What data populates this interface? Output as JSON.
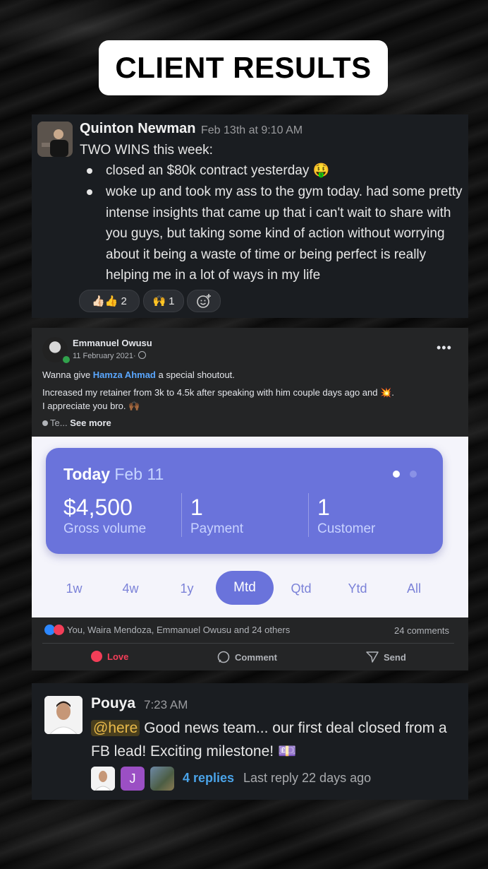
{
  "title": "CLIENT RESULTS",
  "post1": {
    "author": "Quinton Newman",
    "time": "Feb 13th at 9:10 AM",
    "intro": "TWO WINS this week:",
    "bullets": [
      "closed an $80k contract yesterday 🤑",
      "woke up and took my ass to the gym today. had some pretty intense insights that came up that i can't wait to share with you guys, but taking some kind of action without worrying about it being a waste of time or being perfect is really helping me in a lot of ways in my life"
    ],
    "reactions": [
      {
        "emoji": "👍🏻👍",
        "count": "2"
      },
      {
        "emoji": "🙌",
        "count": "1"
      }
    ],
    "add_reaction_icon": "add-emoji-icon"
  },
  "post2": {
    "author": "Emmanuel Owusu",
    "date": "11 February 2021·",
    "line1_prefix": "Wanna give ",
    "line1_link": "Hamza Ahmad",
    "line1_suffix": " a special shoutout.",
    "line2": "Increased my retainer from 3k to 4.5k after speaking with him couple days ago and 💥.",
    "line3": "I appreciate you bro. 🙌🏾",
    "translate_prefix": "Te...",
    "see_more": "See more",
    "stripe": {
      "today": "Today",
      "date": "Feb 11",
      "gross_value": "$4,500",
      "gross_label": "Gross volume",
      "payment_value": "1",
      "payment_label": "Payment",
      "customer_value": "1",
      "customer_label": "Customer",
      "periods": [
        "1w",
        "4w",
        "1y",
        "Mtd",
        "Qtd",
        "Ytd",
        "All"
      ],
      "active_period": "Mtd",
      "accent": "#6a73db"
    },
    "reactions_text": "You, Waira Mendoza, Emmanuel Owusu and 24 others",
    "comments": "24 comments",
    "actions": {
      "love": "Love",
      "comment": "Comment",
      "send": "Send"
    }
  },
  "post3": {
    "author": "Pouya",
    "time": "7:23 AM",
    "mention": "@here",
    "message": " Good news team... our first deal closed from a FB lead! Exciting milestone! 💷",
    "avatar_letter": "J",
    "replies": "4 replies",
    "last_reply": "Last reply 22 days ago"
  }
}
